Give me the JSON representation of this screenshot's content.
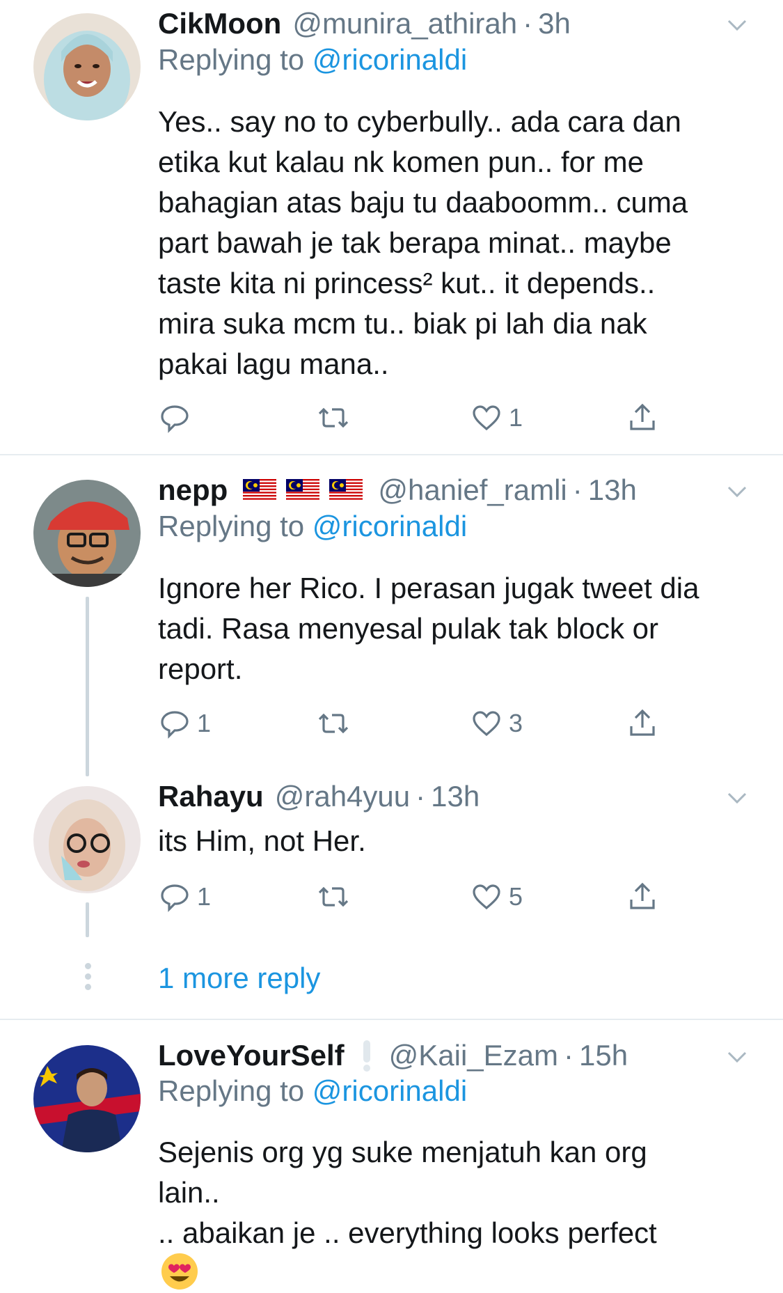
{
  "tweets": [
    {
      "name": "CikMoon",
      "handle": "@munira_athirah",
      "dot": "·",
      "time": "3h",
      "replying_prefix": "Replying to ",
      "replying_to": "@ricorinaldi",
      "text": "Yes.. say no to cyberbully.. ada cara dan\netika kut kalau nk komen pun.. for me\nbahagian atas baju tu daaboomm.. cuma\npart bawah je tak berapa minat.. maybe\ntaste kita ni princess² kut.. it depends..\nmira suka mcm tu.. biak pi lah dia nak\npakai lagu mana..",
      "replies": "",
      "retweets": "",
      "likes": "1"
    },
    {
      "name": "nepp",
      "flags": [
        "malaysia-flag",
        "malaysia-flag",
        "malaysia-flag"
      ],
      "handle": "@hanief_ramli",
      "dot": "·",
      "time": "13h",
      "replying_prefix": "Replying to ",
      "replying_to": "@ricorinaldi",
      "text": "Ignore her Rico. I perasan jugak tweet dia\ntadi. Rasa menyesal pulak tak block or\nreport.",
      "replies": "1",
      "retweets": "",
      "likes": "3"
    },
    {
      "name": "Rahayu",
      "handle": "@rah4yuu",
      "dot": "·",
      "time": "13h",
      "text": "its Him, not Her.",
      "replies": "1",
      "retweets": "",
      "likes": "5"
    },
    {
      "name": "LoveYourSelf",
      "name_emoji": "white-exclamation-icon",
      "handle": "@Kaii_Ezam",
      "dot": "·",
      "time": "15h",
      "replying_prefix": "Replying to ",
      "replying_to": "@ricorinaldi",
      "text": "Sejenis org yg suke menjatuh kan org\nlain..\n.. abaikan je .. everything looks perfect",
      "trailing_emoji": "heart-eyes-emoji"
    }
  ],
  "more_reply": "1 more reply",
  "colors": {
    "link": "#1b95e0",
    "secondary": "#657786",
    "separator": "#e6ecf0",
    "thread_line": "#ccd6dd"
  }
}
